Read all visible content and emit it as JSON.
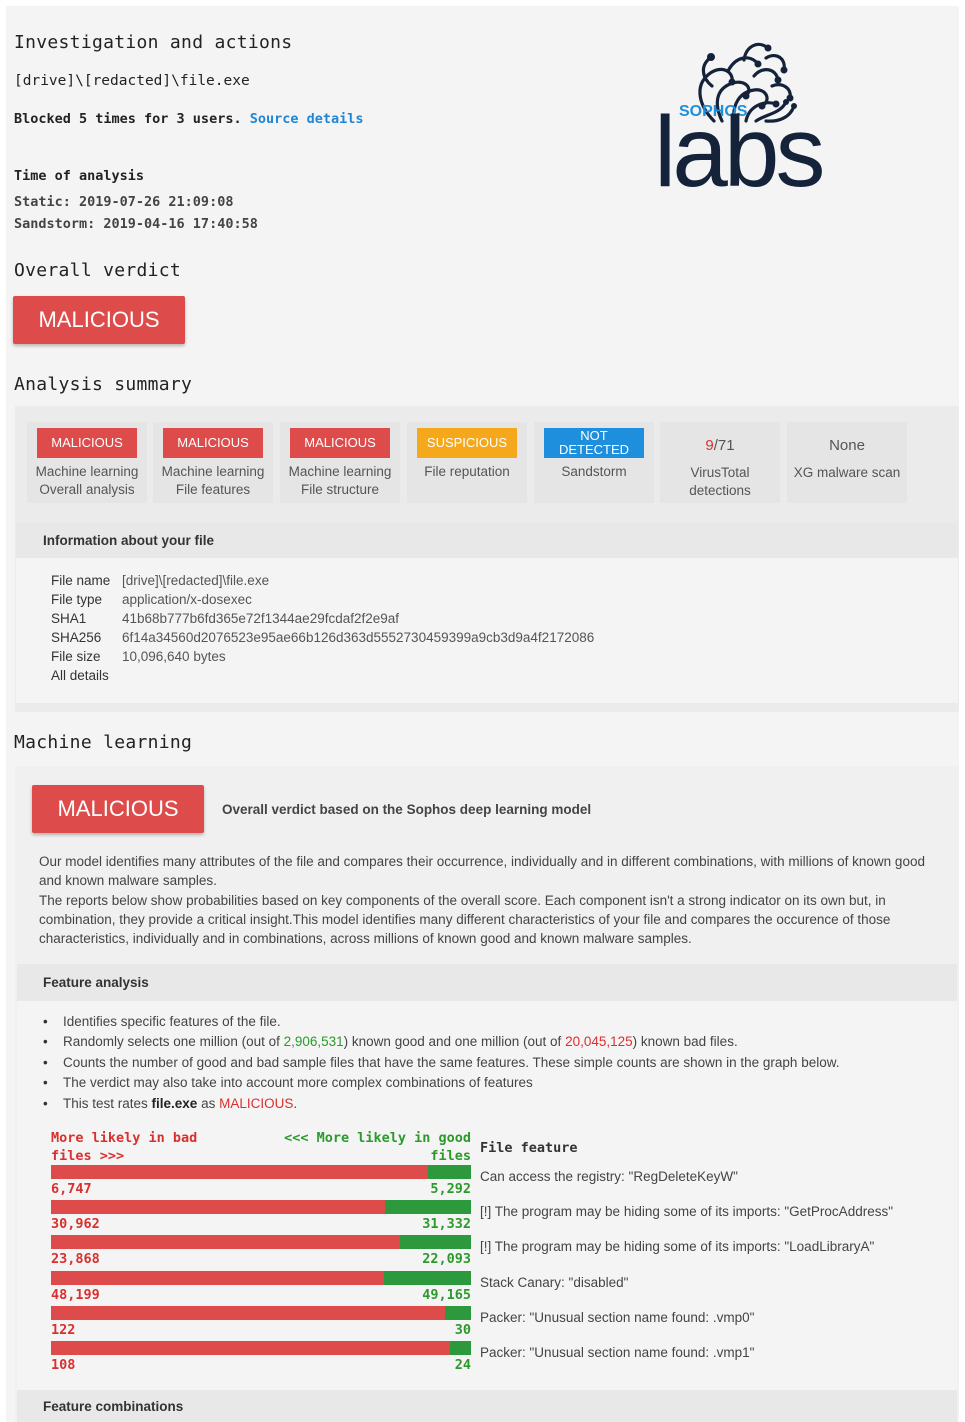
{
  "header": {
    "title": "Investigation and actions",
    "file_path": "[drive]\\[redacted]\\file.exe",
    "blocked_text": "Blocked 5 times for 3 users.",
    "source_link": "Source details",
    "time_label": "Time of analysis",
    "static_time": "Static: 2019-07-26 21:09:08",
    "sandstorm_time": "Sandstorm: 2019-04-16 17:40:58"
  },
  "logo": {
    "brand": "SOPHOS",
    "word": "labs",
    "color": "#14233a",
    "accent": "#1e8fdc"
  },
  "overall": {
    "title": "Overall verdict",
    "verdict": "MALICIOUS",
    "color": "#de4b4b"
  },
  "summary": {
    "title": "Analysis summary",
    "tiles": [
      {
        "badge": "MALICIOUS",
        "badge_color": "red",
        "label1": "Machine learning",
        "label2": "Overall analysis"
      },
      {
        "badge": "MALICIOUS",
        "badge_color": "red",
        "label1": "Machine learning",
        "label2": "File features"
      },
      {
        "badge": "MALICIOUS",
        "badge_color": "red",
        "label1": "Machine learning",
        "label2": "File structure"
      },
      {
        "badge": "SUSPICIOUS",
        "badge_color": "orange",
        "label1": "File reputation",
        "label2": ""
      },
      {
        "badge": "NOT DETECTED",
        "badge_color": "blue",
        "label1": "Sandstorm",
        "label2": ""
      },
      {
        "value_hit": "9",
        "value_total": "/71",
        "label1": "VirusTotal",
        "label2": "detections"
      },
      {
        "value": "None",
        "label1": "XG malware scan",
        "label2": ""
      }
    ]
  },
  "file_info": {
    "heading": "Information about your file",
    "rows": [
      {
        "key": "File name",
        "value": "[drive]\\[redacted]\\file.exe"
      },
      {
        "key": "File type",
        "value": "application/x-dosexec"
      },
      {
        "key": "SHA1",
        "value": "41b68b777b6fd365e72f1344ae29fcdaf2f2e9af"
      },
      {
        "key": "SHA256",
        "value": "6f14a34560d2076523e95ae66b126d363d5552730459399a9cb3d9a4f2172086"
      },
      {
        "key": "File size",
        "value": "10,096,640 bytes"
      }
    ],
    "all_details": "All details"
  },
  "ml": {
    "title": "Machine learning",
    "verdict": "MALICIOUS",
    "verdict_caption": "Overall verdict based on the Sophos deep learning model",
    "para1": "Our model identifies many attributes of the file and compares their occurrence, individually and in different combinations, with millions of known good and known malware samples.",
    "para2": "The reports below show probabilities based on key components of the overall score. Each component isn't a strong indicator on its own but, in combination, they provide a critical insight.This model identifies many different characteristics of your file and compares the occurence of those characteristics, individually and in combinations, across millions of known good and known malware samples."
  },
  "feature_analysis": {
    "heading": "Feature analysis",
    "b1": "Identifies specific features of the file.",
    "b2_pre": "Randomly selects one million (out of ",
    "b2_good": "2,906,531",
    "b2_mid": ") known good and one million (out of ",
    "b2_bad": "20,045,125",
    "b2_post": ") known bad files.",
    "b3": "Counts the number of good and bad sample files that have the same features. These simple counts are shown in the graph below.",
    "b4": "The verdict may also take into account more complex combinations of features",
    "b5_pre": "This test rates ",
    "b5_file": "file.exe",
    "b5_mid": " as ",
    "b5_verdict": "MALICIOUS",
    "b5_post": ".",
    "bad_header": "More likely in bad files >>>",
    "good_header": "<<< More likely in good files",
    "feature_header": "File feature",
    "rows": [
      {
        "bad": "6,747",
        "good": "5,292",
        "bad_value": 6747,
        "good_value": 5292,
        "feature": "Can access the registry: \"RegDeleteKeyW\""
      },
      {
        "bad": "30,962",
        "good": "31,332",
        "bad_value": 30962,
        "good_value": 31332,
        "feature": "[!] The program may be hiding some of its imports: \"GetProcAddress\""
      },
      {
        "bad": "23,868",
        "good": "22,093",
        "bad_value": 23868,
        "good_value": 22093,
        "feature": "[!] The program may be hiding some of its imports: \"LoadLibraryA\""
      },
      {
        "bad": "48,199",
        "good": "49,165",
        "bad_value": 48199,
        "good_value": 49165,
        "feature": "Stack Canary: \"disabled\""
      },
      {
        "bad": "122",
        "good": "30",
        "bad_value": 122,
        "good_value": 30,
        "feature": "Packer: \"Unusual section name found: .vmp0\""
      },
      {
        "bad": "108",
        "good": "24",
        "bad_value": 108,
        "good_value": 24,
        "feature": "Packer: \"Unusual section name found: .vmp1\""
      }
    ]
  },
  "feature_combinations": {
    "heading": "Feature combinations"
  }
}
